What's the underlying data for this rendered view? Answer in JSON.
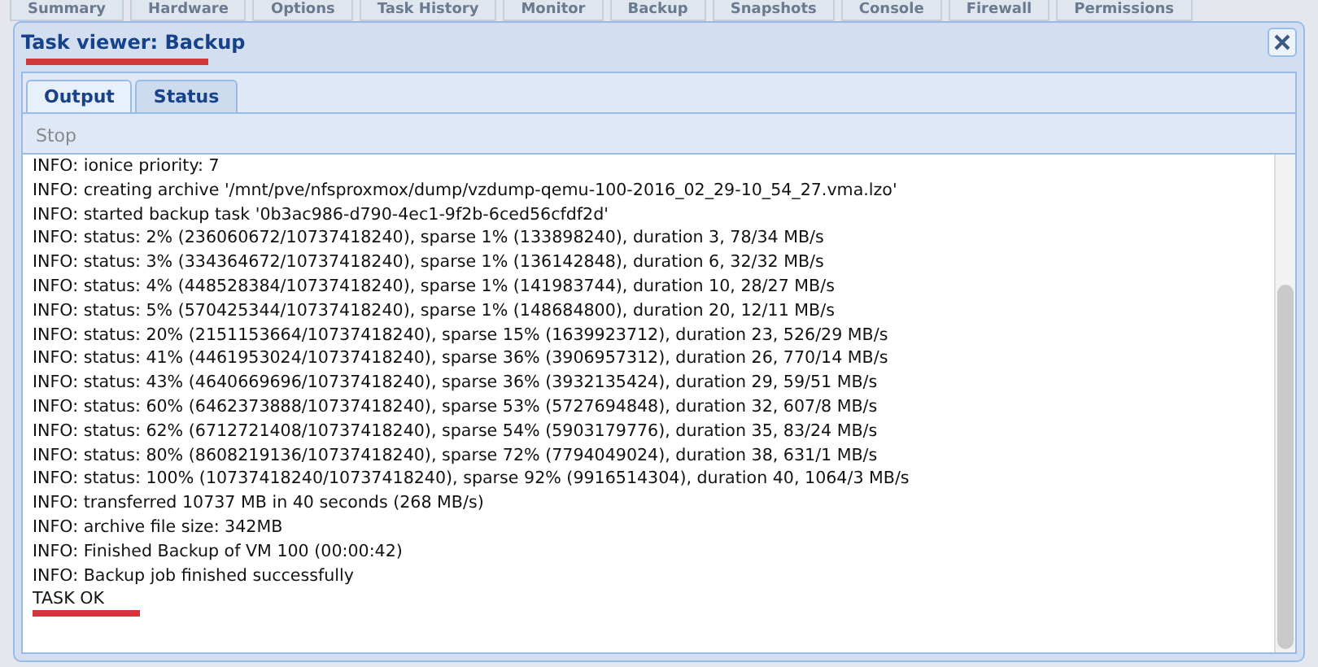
{
  "background_tabs": [
    "Summary",
    "Hardware",
    "Options",
    "Task History",
    "Monitor",
    "Backup",
    "Snapshots",
    "Console",
    "Firewall",
    "Permissions"
  ],
  "window": {
    "title": "Task viewer: Backup"
  },
  "tabs": [
    {
      "label": "Output",
      "selected": true
    },
    {
      "label": "Status",
      "selected": false
    }
  ],
  "toolbar": {
    "stop_button": {
      "label": "Stop",
      "disabled": true
    }
  },
  "log_lines": [
    "INFO: ionice priority: 7",
    "INFO: creating archive '/mnt/pve/nfsproxmox/dump/vzdump-qemu-100-2016_02_29-10_54_27.vma.lzo'",
    "INFO: started backup task '0b3ac986-d790-4ec1-9f2b-6ced56cfdf2d'",
    "INFO: status: 2% (236060672/10737418240), sparse 1% (133898240), duration 3, 78/34 MB/s",
    "INFO: status: 3% (334364672/10737418240), sparse 1% (136142848), duration 6, 32/32 MB/s",
    "INFO: status: 4% (448528384/10737418240), sparse 1% (141983744), duration 10, 28/27 MB/s",
    "INFO: status: 5% (570425344/10737418240), sparse 1% (148684800), duration 20, 12/11 MB/s",
    "INFO: status: 20% (2151153664/10737418240), sparse 15% (1639923712), duration 23, 526/29 MB/s",
    "INFO: status: 41% (4461953024/10737418240), sparse 36% (3906957312), duration 26, 770/14 MB/s",
    "INFO: status: 43% (4640669696/10737418240), sparse 36% (3932135424), duration 29, 59/51 MB/s",
    "INFO: status: 60% (6462373888/10737418240), sparse 53% (5727694848), duration 32, 607/8 MB/s",
    "INFO: status: 62% (6712721408/10737418240), sparse 54% (5903179776), duration 35, 83/24 MB/s",
    "INFO: status: 80% (8608219136/10737418240), sparse 72% (7794049024), duration 38, 631/1 MB/s",
    "INFO: status: 100% (10737418240/10737418240), sparse 92% (9916514304), duration 40, 1064/3 MB/s",
    "INFO: transferred 10737 MB in 40 seconds (268 MB/s)",
    "INFO: archive file size: 342MB",
    "INFO: Finished Backup of VM 100 (00:00:42)",
    "INFO: Backup job finished successfully",
    "TASK OK"
  ]
}
